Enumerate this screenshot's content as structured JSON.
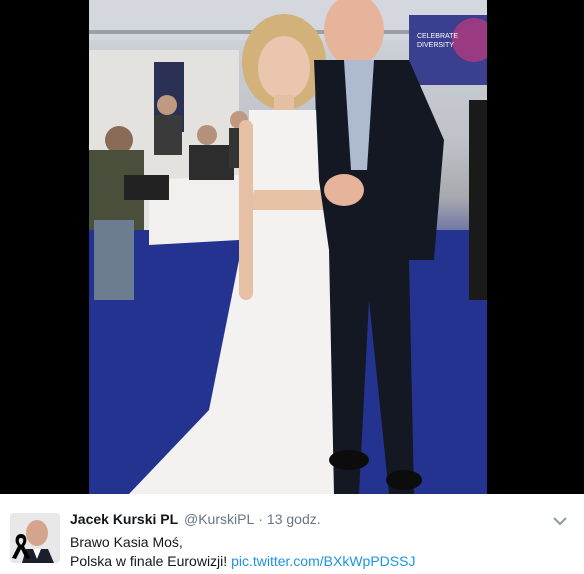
{
  "tweet": {
    "author_name": "Jacek Kurski PL",
    "handle": "@KurskiPL",
    "separator": "·",
    "time": "13 godz.",
    "text_line1": "Brawo Kasia Moś,",
    "text_line2_prefix": "Polska w finale Eurowizji! ",
    "link_text": "pic.twitter.com/BXkWpPDSSJ"
  },
  "photo": {
    "banner_text_1": "CELEBRATE",
    "banner_text_2": "DIVERSITY"
  },
  "icons": {
    "avatar": "avatar",
    "mourning_ribbon": "black-ribbon-icon",
    "menu": "chevron-down-icon"
  },
  "colors": {
    "link": "#1b95e0",
    "text": "#14171a",
    "muted": "#657786",
    "carpet": "#223191"
  }
}
